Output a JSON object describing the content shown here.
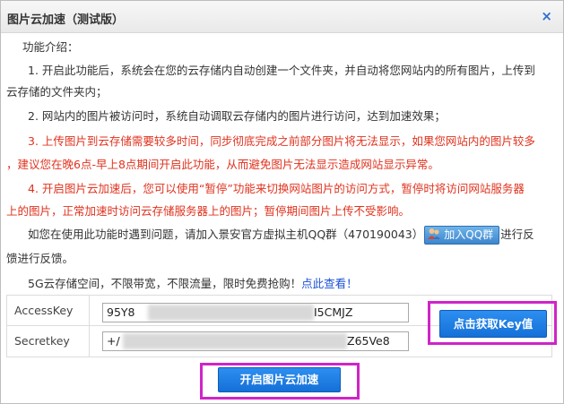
{
  "dialog": {
    "title": "图片云加速（测试版）",
    "close_glyph": "×"
  },
  "intro": {
    "heading": "功能介绍：",
    "item1_line1": "1. 开启此功能后，系统会在您的云存储内自动创建一个文件夹，并自动将您网站内的所有图片，上传到",
    "item1_line2": "云存储的文件夹内；",
    "item2": "2. 网站内的图片被访问时，系统自动调取云存储内的图片进行访问，达到加速效果；",
    "item3_line1": "3. 上传图片到云存储需要较多时间，同步彻底完成之前部分图片将无法显示，如果您网站内的图片较多",
    "item3_line2": "，建议您在晚6点-早上8点期间开启此功能，从而避免图片无法显示造成网站显示异常。",
    "item4_line1": "4. 开启图片云加速后，您可以使用“暂停”功能来切换网站图片的访问方式，暂停时将访问网站服务器",
    "item4_line2": "上的图片，正常加速时访问云存储服务器上的图片；暂停期间图片上传不受影响。",
    "help_prefix": "如您在使用此功能时遇到问题，请加入景安官方虚拟主机QQ群（470190043）",
    "qq_button": "加入QQ群",
    "help_suffix_1": "进行反",
    "help_line2": "馈进行反馈。",
    "promo_text": "5G云存储空间，不限带宽，不限流量，限时免费抢购！",
    "promo_link": "点此查看！"
  },
  "keys": {
    "accesskey_label": "AccessKey",
    "accesskey_visible_start": "95Y8",
    "accesskey_visible_end": "I5CMJZ",
    "secretkey_label": "Secretkey",
    "secretkey_visible_start": "+/",
    "secretkey_visible_end": "Z65Ve8"
  },
  "buttons": {
    "get_key": "点击获取Key值",
    "start": "开启图片云加速"
  },
  "colors": {
    "accent_blue": "#1570d8",
    "warning_red": "#e0321e",
    "highlight_magenta": "#d024c8",
    "link_blue": "#1a4fd6"
  }
}
